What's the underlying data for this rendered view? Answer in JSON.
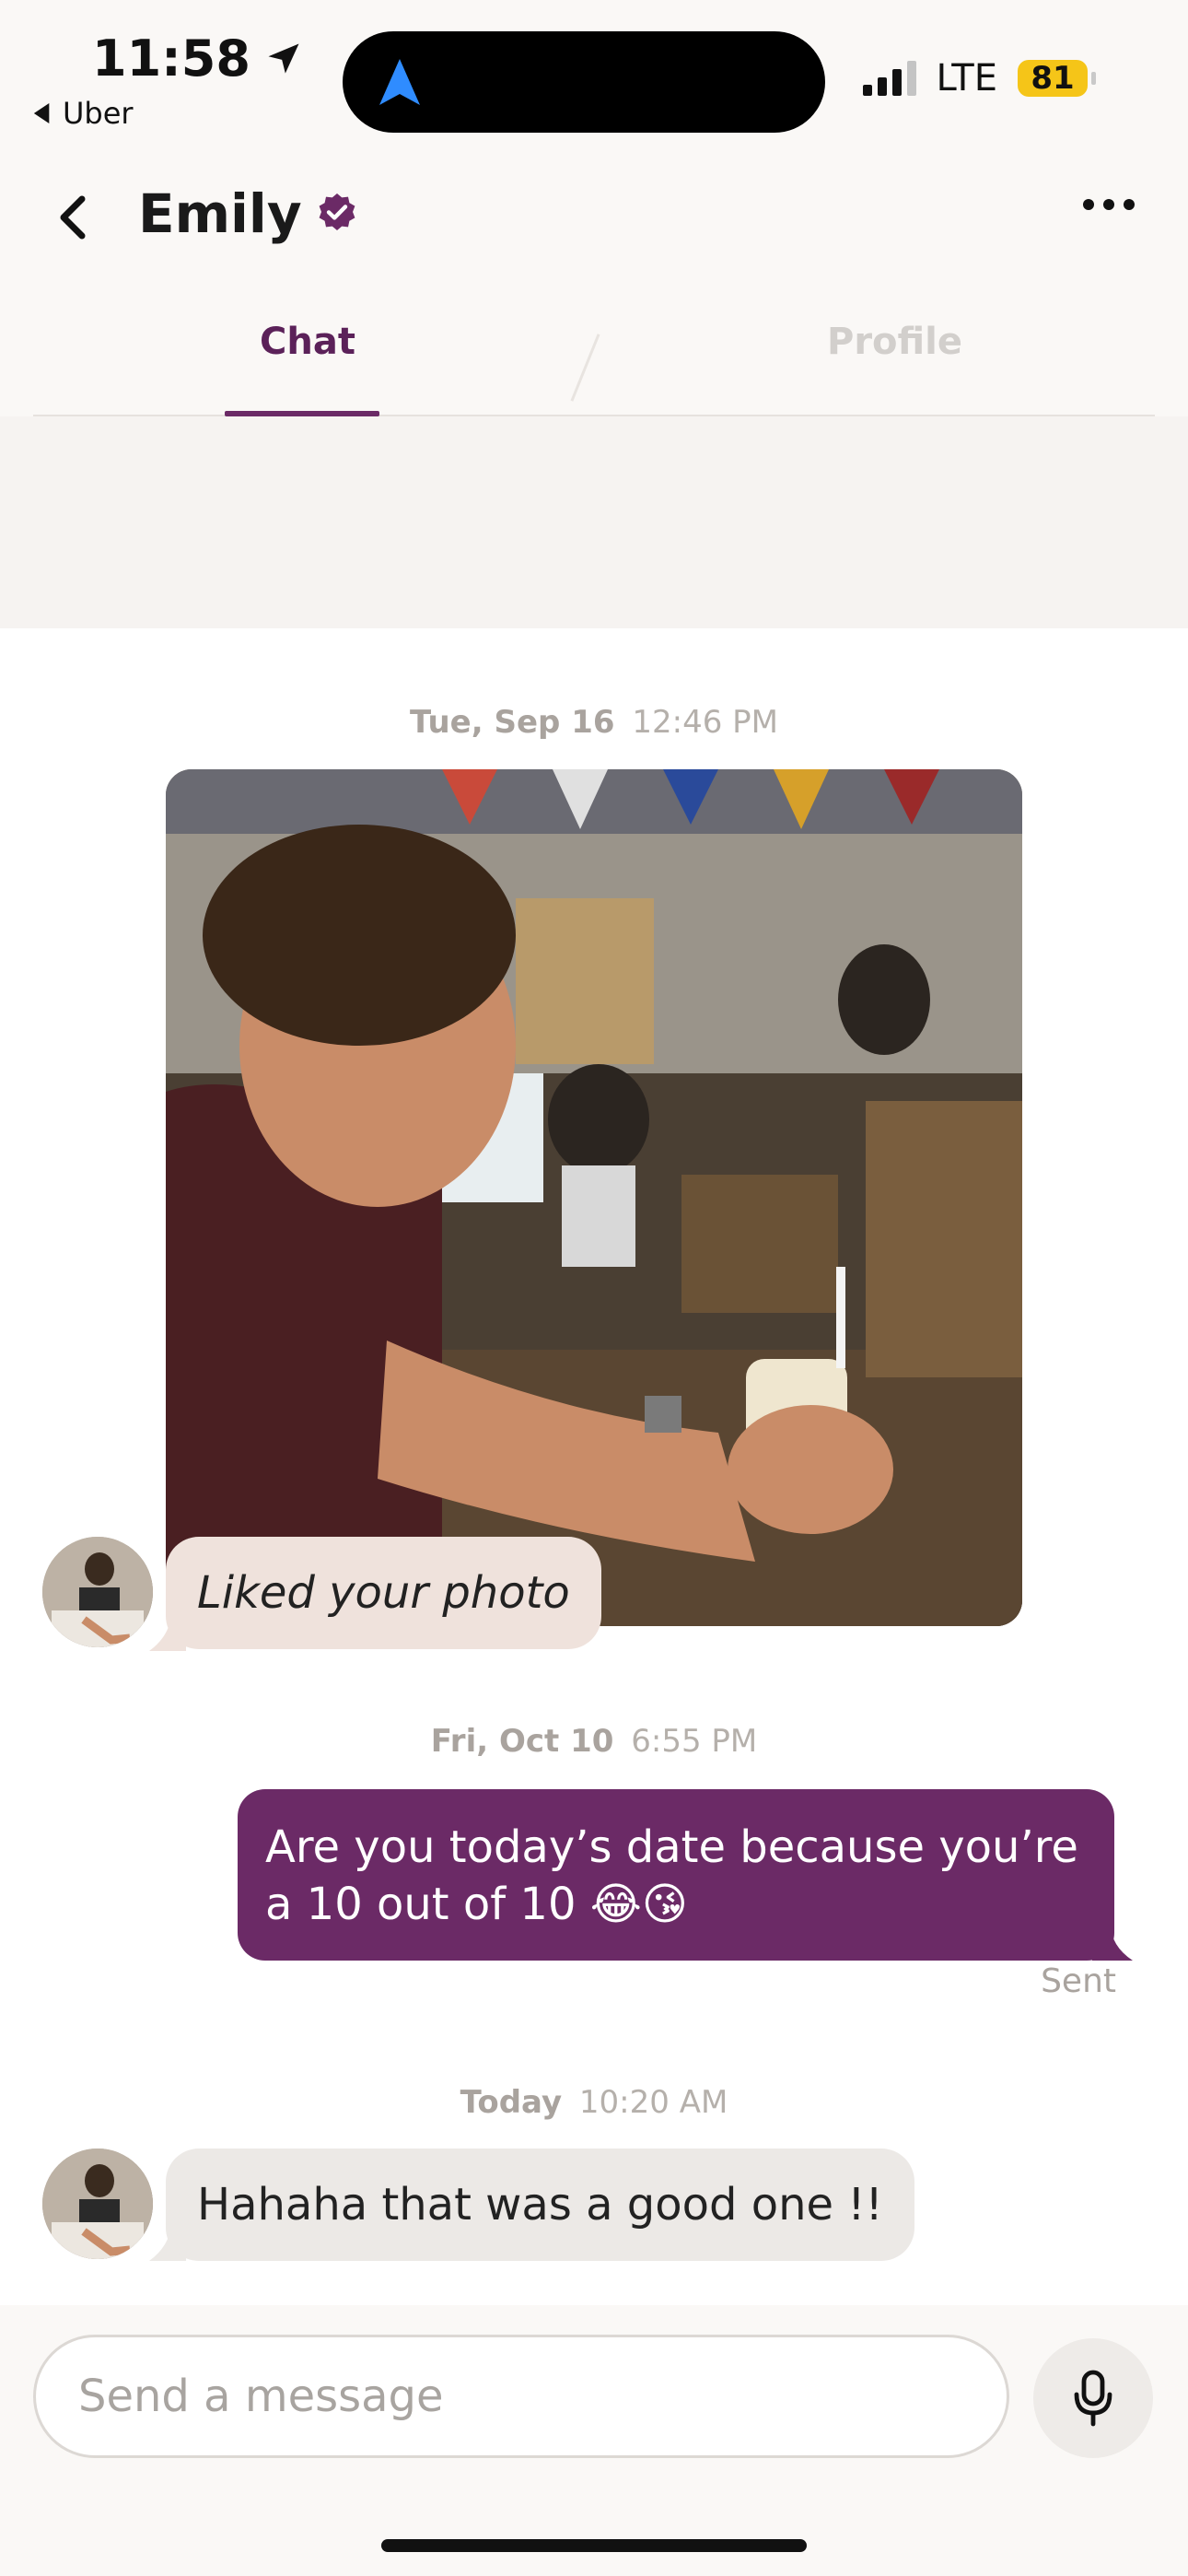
{
  "status_bar": {
    "time": "11:58",
    "back_app": "Uber",
    "network": "LTE",
    "battery": "81"
  },
  "header": {
    "title": "Emily"
  },
  "tabs": [
    {
      "label": "Chat",
      "active": true
    },
    {
      "label": "Profile",
      "active": false
    }
  ],
  "messages": {
    "ts1": {
      "day": "Tue, Sep 16",
      "time": "12:46 PM"
    },
    "liked": "Liked your photo",
    "ts2": {
      "day": "Fri, Oct 10",
      "time": "6:55 PM"
    },
    "sent_text": "Are you today’s date because you’re a 10 out of 10 😂😘",
    "sent_status": "Sent",
    "ts3": {
      "day": "Today",
      "time": "10:20 AM"
    },
    "reply": "Hahaha that was a good one !!"
  },
  "composer": {
    "placeholder": "Send a message"
  },
  "colors": {
    "accent": "#6b2a66",
    "tab_active": "#5b2159",
    "battery": "#f5c518"
  },
  "icons": [
    "location-arrow-icon",
    "back-chevron-icon",
    "verified-badge-icon",
    "more-icon",
    "microphone-icon",
    "navigation-icon"
  ]
}
